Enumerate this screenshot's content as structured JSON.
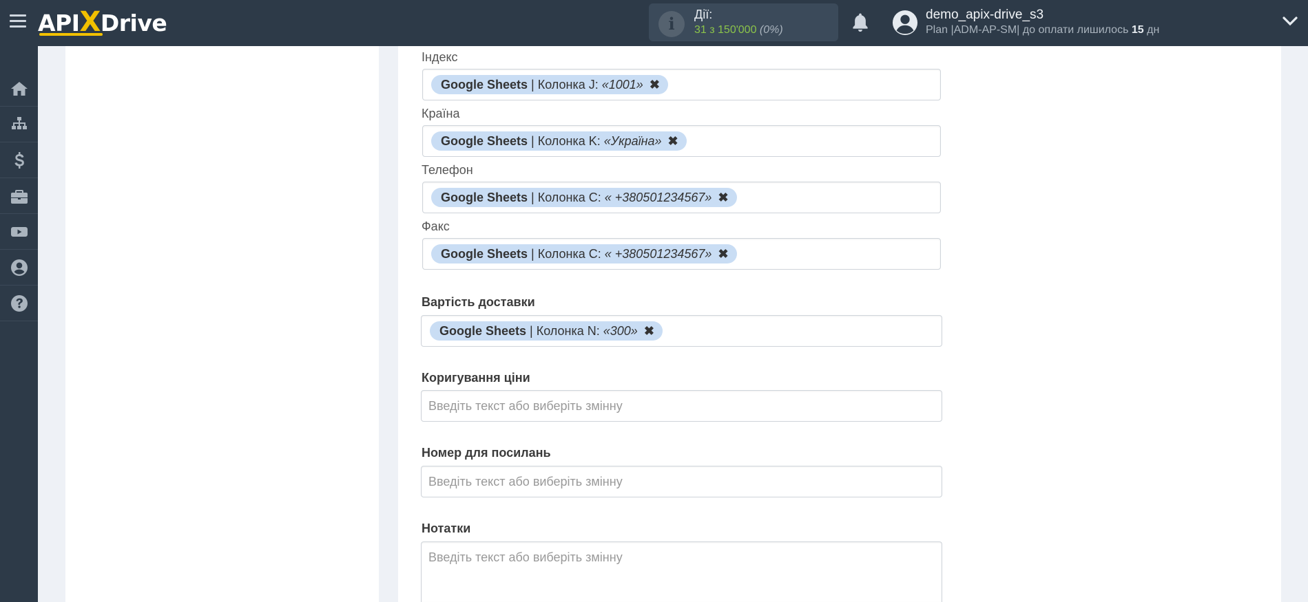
{
  "header": {
    "logo_text_left": "API",
    "logo_text_x": "X",
    "logo_text_right": "Drive",
    "actions_label": "Дії:",
    "actions_count": "31 з 150'000",
    "actions_percent": "(0%)",
    "user_name": "demo_apix-drive_s3",
    "plan_text": "Plan |ADM-AP-SM| до оплати лишилось",
    "plan_days": "15",
    "plan_days_unit": "дн"
  },
  "sidebar": {
    "items": [
      {
        "icon": "home-icon"
      },
      {
        "icon": "sitemap-icon"
      },
      {
        "icon": "dollar-icon"
      },
      {
        "icon": "briefcase-icon"
      },
      {
        "icon": "youtube-icon"
      },
      {
        "icon": "user-circle-icon"
      },
      {
        "icon": "question-icon"
      }
    ]
  },
  "form": {
    "fields": [
      {
        "label": "Індекс",
        "source": "Google Sheets",
        "column": " | Колонка J: ",
        "value": "«1001»"
      },
      {
        "label": "Країна",
        "source": "Google Sheets",
        "column": " | Колонка K: ",
        "value": "«Україна»"
      },
      {
        "label": "Телефон",
        "source": "Google Sheets",
        "column": " | Колонка C: ",
        "value": "« +380501234567»"
      },
      {
        "label": "Факс",
        "source": "Google Sheets",
        "column": " | Колонка C: ",
        "value": "« +380501234567»"
      },
      {
        "label": "Вартість доставки",
        "source": "Google Sheets",
        "column": " | Колонка N: ",
        "value": "«300»"
      }
    ],
    "empty_fields": [
      {
        "label": "Коригування ціни",
        "placeholder": "Введіть текст або виберіть змінну"
      },
      {
        "label": "Номер для посилань",
        "placeholder": "Введіть текст або виберіть змінну"
      },
      {
        "label": "Нотатки",
        "placeholder": "Введіть текст або виберіть змінну"
      }
    ],
    "remove_glyph": "✖"
  },
  "colors": {
    "topbar": "#2d3a48",
    "accent_yellow": "#f2c100",
    "chip_bg": "#c9ddf4",
    "count_green": "#8bc34a"
  }
}
